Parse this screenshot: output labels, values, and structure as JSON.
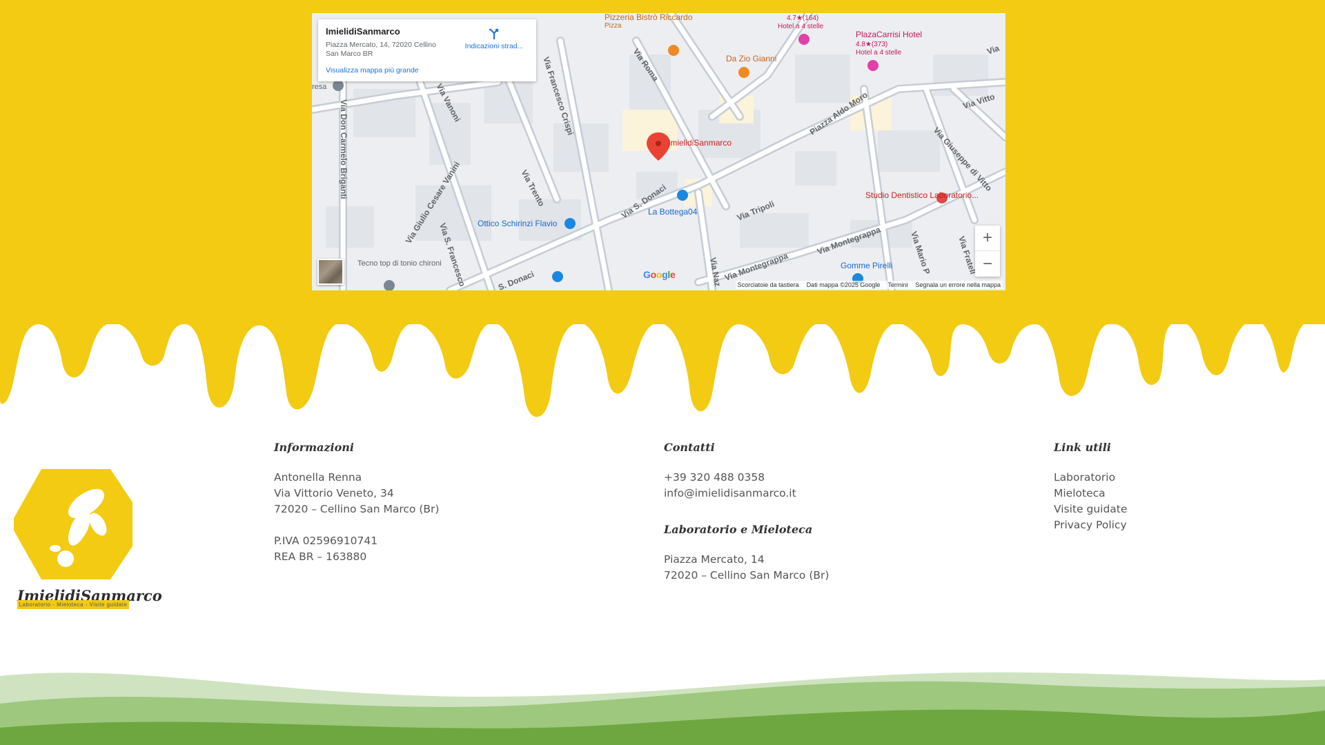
{
  "colors": {
    "honey": "#f2cb12",
    "hill_light": "#cfe3c0",
    "hill_mid": "#9dc87e",
    "hill_dark": "#6ea63f"
  },
  "map": {
    "card": {
      "name": "ImielidiSanmarco",
      "address": "Piazza Mercato, 14, 72020 Cellino San Marco BR",
      "directions_label": "Indicazioni strad...",
      "bigger_map_link": "Visualizza mappa più grande"
    },
    "marker_label": "ImielidiSanmarco",
    "labels": {
      "pizzeria": "Pizzeria Bistrò Riccardo",
      "pizzeria_sub": "Pizza",
      "hotel1_rating": "4.7★(164)",
      "hotel1_sub": "Hotel a 4 stelle",
      "hotel2": "PlazaCarrisi Hotel",
      "hotel2_rating": "4.8★(373)",
      "hotel2_sub": "Hotel a 4 stelle",
      "zio_gianni": "Da Zio Gianni",
      "ottico": "Ottico Schirinzi Flavio",
      "bottega": "La Bottega04",
      "dentist": "Studio Dentistico Laboratorio...",
      "gomme": "Gomme Pirelli",
      "tecno": "Tecno top di tonio chironi",
      "resa": "resa"
    },
    "streets": {
      "via_roma": "Via Roma",
      "via_vanoni": "Via Vanoni",
      "via_crispi": "Via Francesco Crispi",
      "via_briganti": "Via Don Carmelo Briganti",
      "via_trento": "Via Trento",
      "via_vanini": "Via Giulio Cesare Vanini",
      "via_s_francesco": "Via S. Francesco",
      "via_s_donaci": "Via S. Donaci",
      "s_donaci": "S. Donaci",
      "via_tripoli": "Via Tripoli",
      "via_montegrappa": "Via Montegrappa",
      "via_montegrappa2": "Via Montegrappa",
      "piazza_aldo_moro": "Piazza Aldo Moro",
      "via_vittorio": "Via Vitto",
      "via_giuseppe": "Via Giuseppe di Vitto",
      "via_mario_p": "Via Mario P",
      "via_fratelli": "Via Fratell",
      "via_naz": "Via Naz",
      "via_top": "Via"
    },
    "zoom_in": "+",
    "zoom_out": "−",
    "google": {
      "g": "G",
      "o1": "o",
      "o2": "o",
      "g2": "g",
      "l": "l",
      "e": "e"
    },
    "attribution": {
      "shortcuts": "Scorciatoie da tastiera",
      "data": "Dati mappa ©2025 Google",
      "terms": "Termini",
      "report": "Segnala un errore nella mappa"
    }
  },
  "logo": {
    "wordmark": "ImielidiSanmarco",
    "tagline": "Laboratorio - Mieloteca - Visite guidate"
  },
  "footer": {
    "info": {
      "heading": "Informazioni",
      "name": "Antonella Renna",
      "street": "Via Vittorio Veneto, 34",
      "city": "72020 – Cellino San Marco (Br)",
      "piva": "P.IVA 02596910741",
      "rea": "REA BR – 163880"
    },
    "contact": {
      "heading": "Contatti",
      "phone": "+39 320 488 0358",
      "email": "info@imielidisanmarco.it",
      "lab_heading": "Laboratorio e Mieloteca",
      "lab_street": "Piazza Mercato, 14",
      "lab_city": "72020 – Cellino San Marco (Br)"
    },
    "links": {
      "heading": "Link utili",
      "items": [
        "Laboratorio",
        "Mieloteca",
        "Visite guidate",
        "Privacy Policy"
      ]
    }
  }
}
